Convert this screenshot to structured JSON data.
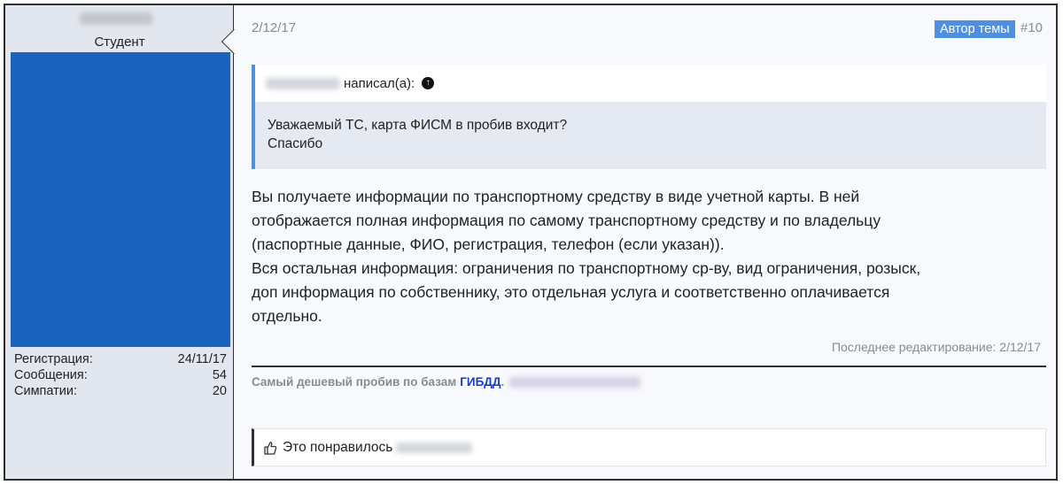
{
  "author": {
    "title": "Студент",
    "stats": [
      {
        "label": "Регистрация:",
        "value": "24/11/17"
      },
      {
        "label": "Сообщения:",
        "value": "54"
      },
      {
        "label": "Симпатии:",
        "value": "20"
      }
    ],
    "avatar_color": "#1b62bd"
  },
  "post": {
    "date": "2/12/17",
    "author_badge": "Автор темы",
    "number": "#10",
    "quote": {
      "wrote_label": "написал(а):",
      "lines": [
        "Уважаемый ТС, карта ФИСМ в пробив входит?",
        "Спасибо"
      ]
    },
    "message_lines": [
      "Вы получаете информации по транспортному средству в виде учетной карты. В ней",
      "отображается полная информация по самому транспортному средству и по владельцу",
      "(паспортные данные, ФИО, регистрация, телефон (если указан)).",
      "Вся остальная информация: ограничения по транспортному ср-ву, вид ограничения, розыск,",
      "доп информация по собственнику, это отдельная услуга и соответственно оплачивается",
      "отдельно."
    ],
    "edited": "Последнее редактирование: 2/12/17",
    "signature": {
      "text": "Самый дешевый пробив по базам",
      "link": "ГИБДД",
      "punct": "."
    },
    "likes_label": "Это понравилось"
  },
  "colors": {
    "accent": "#4f8fdf",
    "link": "#1d3bc0",
    "muted": "#8b8b8b"
  }
}
